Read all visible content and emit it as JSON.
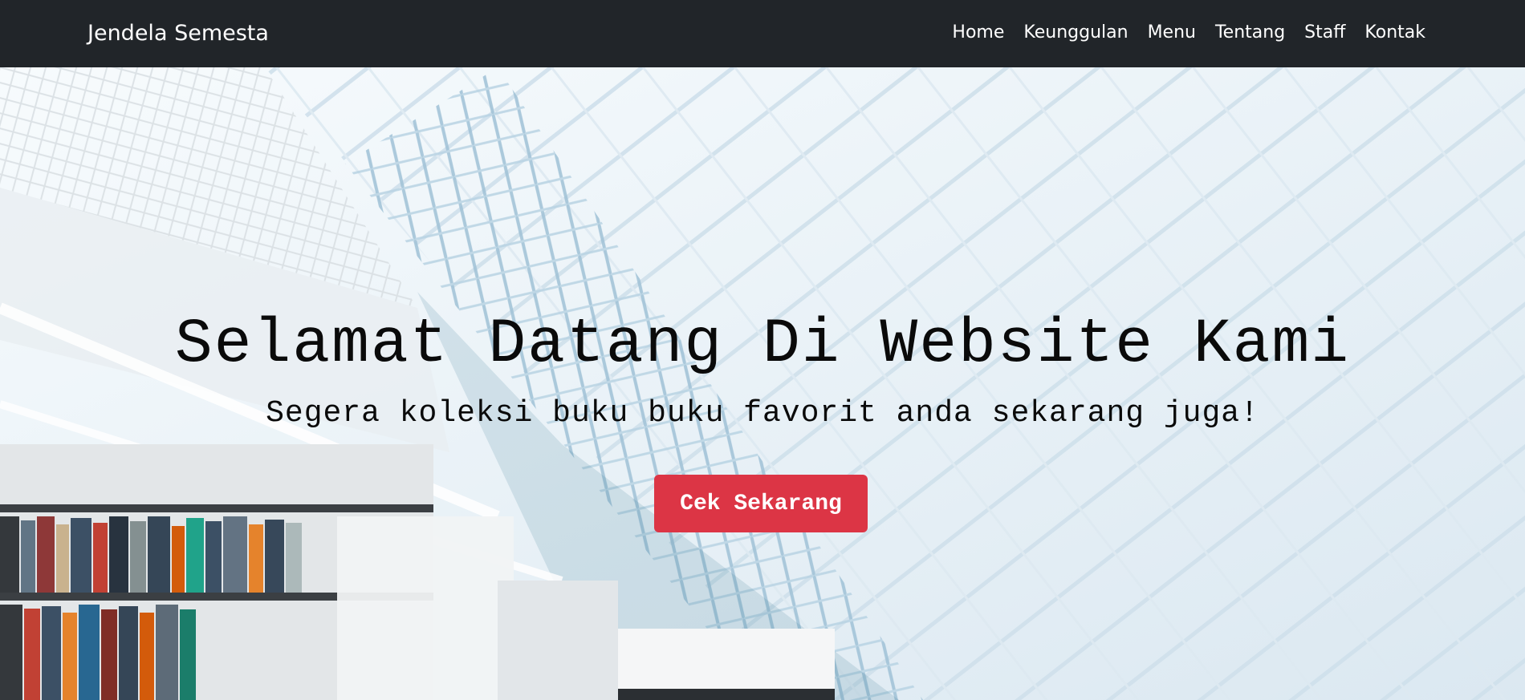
{
  "navbar": {
    "brand": "Jendela Semesta",
    "links": [
      {
        "label": "Home"
      },
      {
        "label": "Keunggulan"
      },
      {
        "label": "Menu"
      },
      {
        "label": "Tentang"
      },
      {
        "label": "Staff"
      },
      {
        "label": "Kontak"
      }
    ]
  },
  "hero": {
    "title": "Selamat Datang Di Website Kami",
    "subtitle": "Segera koleksi buku buku favorit anda sekarang juga!",
    "cta_label": "Cek Sekarang"
  },
  "colors": {
    "navbar_bg": "#212529",
    "cta_bg": "#dc3545",
    "nav_text": "#ffffff"
  }
}
